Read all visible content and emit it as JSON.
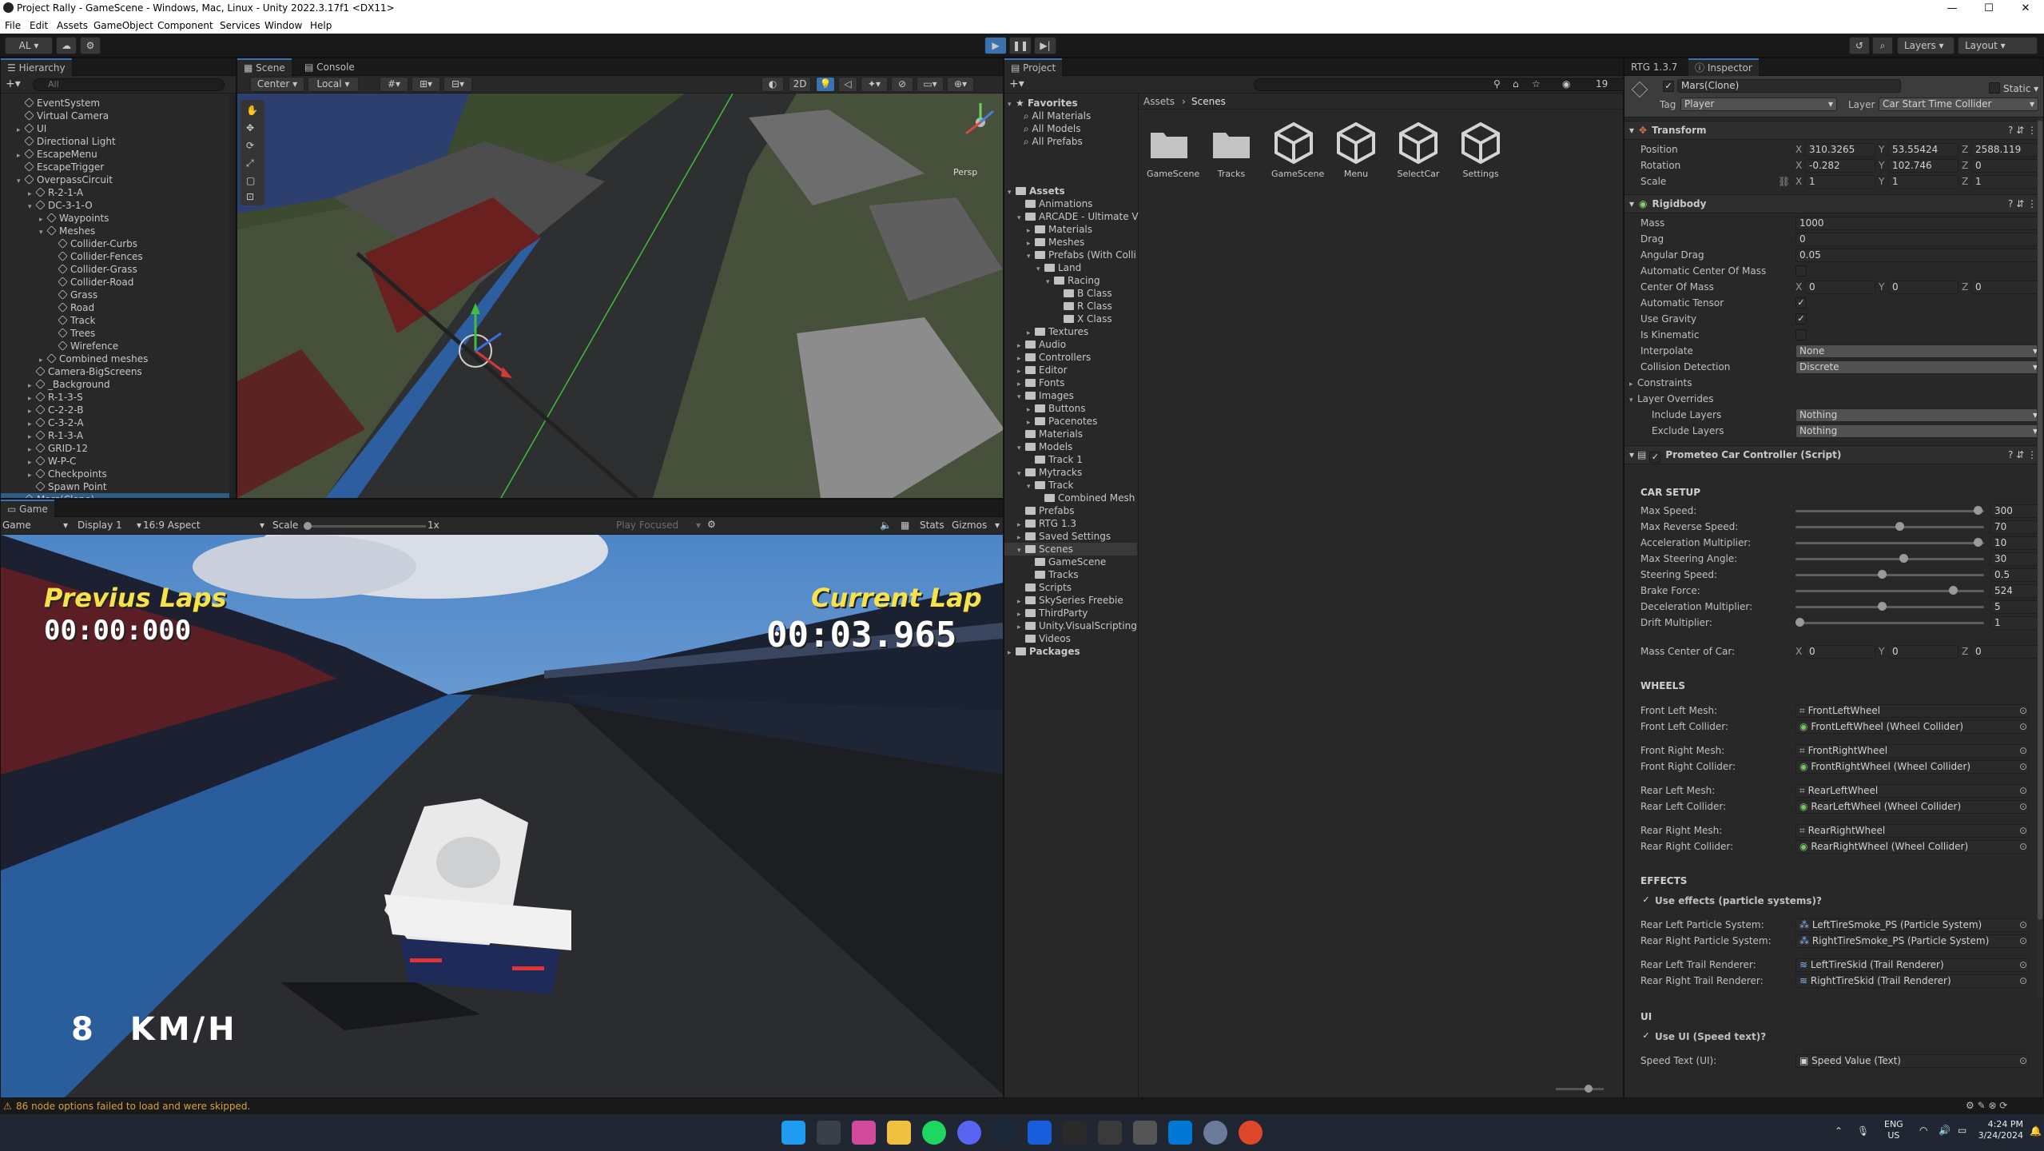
{
  "window": {
    "title": "Project Rally - GameScene - Windows, Mac, Linux - Unity 2022.3.17f1 <DX11>",
    "minimize": "—",
    "maximize": "☐",
    "close": "✕"
  },
  "menu": [
    "File",
    "Edit",
    "Assets",
    "GameObject",
    "Component",
    "Services",
    "Window",
    "Help"
  ],
  "toolbar": {
    "account": "AL",
    "layers": "Layers",
    "layout": "Layout"
  },
  "hierarchy": {
    "tab": "Hierarchy",
    "search": "All",
    "items": [
      "EventSystem",
      "Virtual Camera",
      "UI",
      "Directional Light",
      "EscapeMenu",
      "EscapeTrigger",
      "OverpassCircuit",
      "R-2-1-A",
      "DC-3-1-O",
      "Waypoints",
      "Meshes",
      "Collider-Curbs",
      "Collider-Fences",
      "Collider-Grass",
      "Collider-Road",
      "Grass",
      "Road",
      "Track",
      "Trees",
      "Wirefence",
      "Combined meshes",
      "Camera-BigScreens",
      "_Background",
      "R-1-3-S",
      "C-2-2-B",
      "C-3-2-A",
      "R-1-3-A",
      "GRID-12",
      "W-P-C",
      "Checkpoints",
      "Spawn Point",
      "Mars(Clone)"
    ]
  },
  "scene": {
    "tabs": [
      "Scene",
      "Console"
    ],
    "center": "Center",
    "local": "Local",
    "mode2d": "2D",
    "persp": "Persp"
  },
  "game": {
    "tab": "Game",
    "mode": "Game",
    "display": "Display 1",
    "aspect": "16:9 Aspect",
    "scale_label": "Scale",
    "scale_value": "1x",
    "play_focused": "Play Focused",
    "stats": "Stats",
    "gizmos": "Gizmos",
    "prev_laps_label": "Previus Laps",
    "prev_laps_time": "00:00:000",
    "current_lap_label": "Current Lap",
    "current_lap_time": "00:03.965",
    "speed": "8 KM/H"
  },
  "project": {
    "tab": "Project",
    "breadcrumb": [
      "Assets",
      "Scenes"
    ],
    "badge": "19",
    "favorites_label": "Favorites",
    "favorites": [
      "All Materials",
      "All Models",
      "All Prefabs"
    ],
    "tree": [
      "Assets",
      "Animations",
      "ARCADE - Ultimate V",
      "Materials",
      "Meshes",
      "Prefabs (With Colli",
      "Land",
      "Racing",
      "B Class",
      "R Class",
      "X Class",
      "Textures",
      "Audio",
      "Controllers",
      "Editor",
      "Fonts",
      "Images",
      "Buttons",
      "Pacenotes",
      "Materials",
      "Models",
      "Track 1",
      "Mytracks",
      "Track",
      "Combined Mesh",
      "Prefabs",
      "RTG 1.3",
      "Saved Settings",
      "Scenes",
      "GameScene",
      "Tracks",
      "Scripts",
      "SkySeries Freebie",
      "ThirdParty",
      "Unity.VisualScripting",
      "Videos",
      "Packages"
    ],
    "files": [
      "GameScene",
      "Tracks",
      "GameScene",
      "Menu",
      "SelectCar",
      "Settings"
    ]
  },
  "inspector": {
    "tabs": [
      "RTG 1.3.7",
      "Inspector"
    ],
    "object_name": "Mars(Clone)",
    "static_label": "Static",
    "tag_label": "Tag",
    "tag": "Player",
    "layer_label": "Layer",
    "layer": "Car Start Time Collider",
    "transform": {
      "title": "Transform",
      "position_label": "Position",
      "position": [
        "310.3265",
        "53.55424",
        "2588.119"
      ],
      "rotation_label": "Rotation",
      "rotation": [
        "-0.282",
        "102.746",
        "0"
      ],
      "scale_label": "Scale",
      "scale": [
        "1",
        "1",
        "1"
      ]
    },
    "rigidbody": {
      "title": "Rigidbody",
      "mass_label": "Mass",
      "mass": "1000",
      "drag_label": "Drag",
      "drag": "0",
      "angular_drag_label": "Angular Drag",
      "angular_drag": "0.05",
      "auto_com_label": "Automatic Center Of Mass",
      "com_label": "Center Of Mass",
      "com": [
        "0",
        "0",
        "0"
      ],
      "auto_tensor_label": "Automatic Tensor",
      "use_gravity_label": "Use Gravity",
      "is_kinematic_label": "Is Kinematic",
      "interpolate_label": "Interpolate",
      "interpolate": "None",
      "collision_label": "Collision Detection",
      "collision": "Discrete",
      "constraints_label": "Constraints",
      "layer_overrides_label": "Layer Overrides",
      "include_label": "Include Layers",
      "include": "Nothing",
      "exclude_label": "Exclude Layers",
      "exclude": "Nothing"
    },
    "controller": {
      "title": "Prometeo Car Controller (Script)",
      "car_setup": "CAR SETUP",
      "sliders": [
        {
          "label": "Max Speed:",
          "value": "300",
          "fraction": 0.98
        },
        {
          "label": "Max Reverse Speed:",
          "value": "70",
          "fraction": 0.55
        },
        {
          "label": "Acceleration Multiplier:",
          "value": "10",
          "fraction": 0.98
        },
        {
          "label": "Max Steering Angle:",
          "value": "30",
          "fraction": 0.57
        },
        {
          "label": "Steering Speed:",
          "value": "0.5",
          "fraction": 0.45
        },
        {
          "label": "Brake Force:",
          "value": "524",
          "fraction": 0.84
        },
        {
          "label": "Deceleration Multiplier:",
          "value": "5",
          "fraction": 0.45
        },
        {
          "label": "Drift Multiplier:",
          "value": "1",
          "fraction": 0.0
        }
      ],
      "mass_center_label": "Mass Center of Car:",
      "mass_center": [
        "0",
        "0",
        "0"
      ],
      "wheels_title": "WHEELS",
      "wheels": [
        {
          "label": "Front Left Mesh:",
          "value": "FrontLeftWheel"
        },
        {
          "label": "Front Left Collider:",
          "value": "FrontLeftWheel (Wheel Collider)"
        },
        {
          "label": "Front Right Mesh:",
          "value": "FrontRightWheel"
        },
        {
          "label": "Front Right Collider:",
          "value": "FrontRightWheel (Wheel Collider)"
        },
        {
          "label": "Rear Left Mesh:",
          "value": "RearLeftWheel"
        },
        {
          "label": "Rear Left Collider:",
          "value": "RearLeftWheel (Wheel Collider)"
        },
        {
          "label": "Rear Right Mesh:",
          "value": "RearRightWheel"
        },
        {
          "label": "Rear Right Collider:",
          "value": "RearRightWheel (Wheel Collider)"
        }
      ],
      "effects_title": "EFFECTS",
      "use_effects": "Use effects (particle systems)?",
      "effects": [
        {
          "label": "Rear Left Particle System:",
          "value": "LeftTireSmoke_PS (Particle System)"
        },
        {
          "label": "Rear Right Particle System:",
          "value": "RightTireSmoke_PS (Particle System)"
        },
        {
          "label": "Rear Left Trail Renderer:",
          "value": "LeftTireSkid (Trail Renderer)"
        },
        {
          "label": "Rear Right Trail Renderer:",
          "value": "RightTireSkid (Trail Renderer)"
        }
      ],
      "ui_title": "UI",
      "use_ui": "Use UI (Speed text)?",
      "speed_text_label": "Speed Text (UI):",
      "speed_text": "Speed Value (Text)"
    }
  },
  "status": {
    "warning": "86 node options failed to load and were skipped."
  },
  "taskbar": {
    "lang1": "ENG",
    "lang2": "US",
    "time": "4:24 PM",
    "date": "3/24/2024"
  }
}
